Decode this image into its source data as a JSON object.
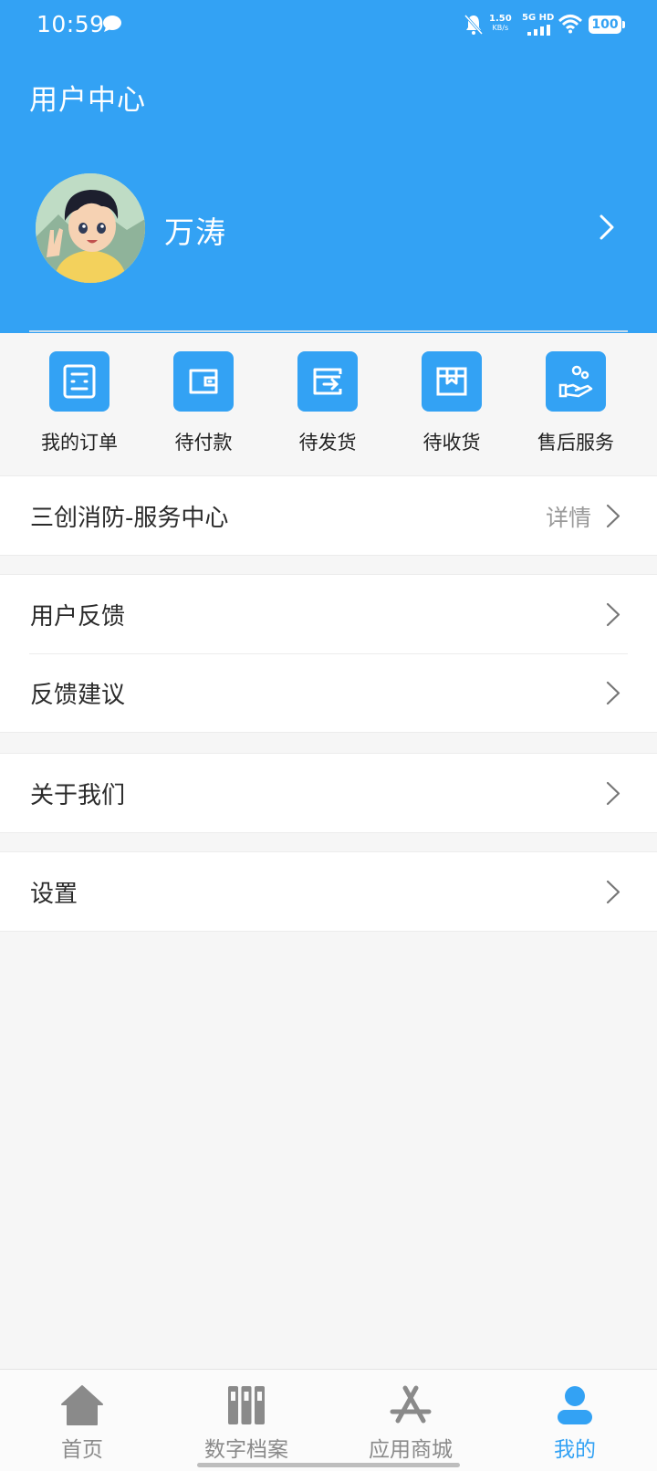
{
  "status_bar": {
    "time": "10:59",
    "net_speed": "1.50",
    "net_unit": "KB/s",
    "signal": "5G HD",
    "battery": "100"
  },
  "header": {
    "title": "用户中心",
    "user_name": "万涛"
  },
  "colors": {
    "brand": "#33a2f4",
    "background": "#f6f6f6",
    "text": "#2b2b2b",
    "muted": "#9a9a9a"
  },
  "orders": [
    {
      "label": "我的订单",
      "icon": "order-list-icon"
    },
    {
      "label": "待付款",
      "icon": "wallet-icon"
    },
    {
      "label": "待发货",
      "icon": "ship-out-icon"
    },
    {
      "label": "待收货",
      "icon": "package-icon"
    },
    {
      "label": "售后服务",
      "icon": "after-sales-icon"
    }
  ],
  "service_center": {
    "label": "三创消防-服务中心",
    "detail": "详情"
  },
  "feedback_group": [
    {
      "label": "用户反馈"
    },
    {
      "label": "反馈建议"
    }
  ],
  "about": {
    "label": "关于我们"
  },
  "settings": {
    "label": "设置"
  },
  "bottom_nav": [
    {
      "label": "首页",
      "icon": "home-icon"
    },
    {
      "label": "数字档案",
      "icon": "archive-icon"
    },
    {
      "label": "应用商城",
      "icon": "app-store-icon"
    },
    {
      "label": "我的",
      "icon": "user-icon",
      "active": true
    }
  ]
}
